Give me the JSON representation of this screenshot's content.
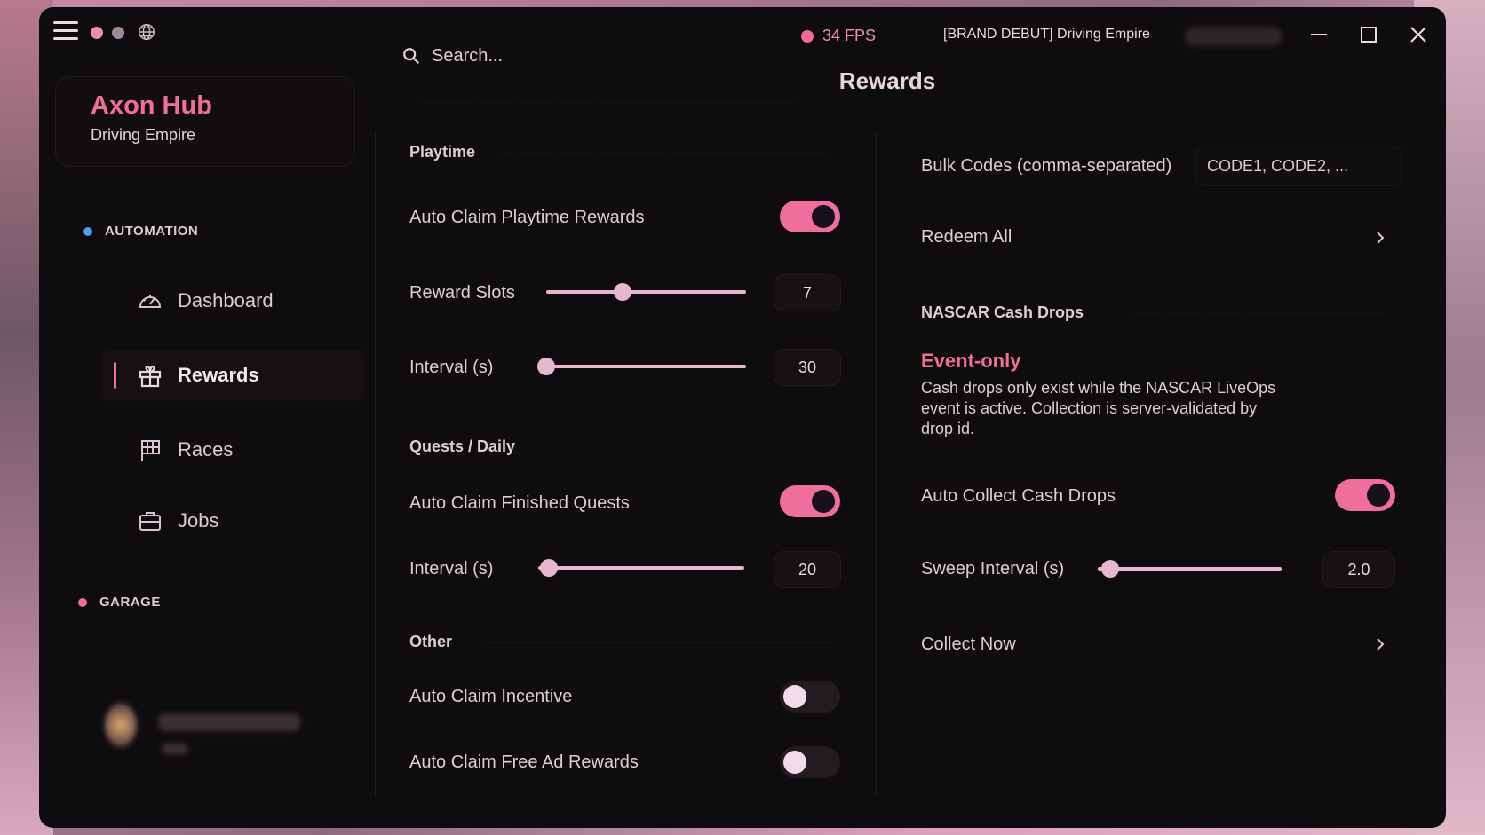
{
  "topbar": {
    "search_placeholder": "Search...",
    "fps": "34 FPS",
    "game_title": "[BRAND DEBUT] Driving Empire",
    "colors": {
      "dot1": "#e98fb0",
      "dot2": "#9a8a93",
      "accent": "#ef6e9c"
    }
  },
  "page": {
    "title": "Rewards"
  },
  "sidebar": {
    "brand_name": "Axon Hub",
    "brand_sub": "Driving Empire",
    "sections": [
      {
        "label": "AUTOMATION",
        "color": "#4b9df0"
      },
      {
        "label": "GARAGE",
        "color": "#ef6e9c"
      }
    ],
    "items": [
      {
        "label": "Dashboard",
        "icon": "gauge-icon"
      },
      {
        "label": "Rewards",
        "icon": "gift-icon",
        "active": true
      },
      {
        "label": "Races",
        "icon": "flag-icon"
      },
      {
        "label": "Jobs",
        "icon": "briefcase-icon"
      }
    ]
  },
  "left_panel": {
    "playtime": {
      "title": "Playtime",
      "auto_claim": {
        "label": "Auto Claim Playtime Rewards",
        "on": true
      },
      "reward_slots": {
        "label": "Reward Slots",
        "value": "7",
        "fraction": 0.38
      },
      "interval": {
        "label": "Interval (s)",
        "value": "30",
        "fraction": 0.03
      }
    },
    "quests": {
      "title": "Quests / Daily",
      "auto_claim": {
        "label": "Auto Claim Finished Quests",
        "on": true
      },
      "interval": {
        "label": "Interval (s)",
        "value": "20",
        "fraction": 0.05
      }
    },
    "other": {
      "title": "Other",
      "incentive": {
        "label": "Auto Claim Incentive",
        "on": false
      },
      "free_ad": {
        "label": "Auto Claim Free Ad Rewards",
        "on": false
      }
    }
  },
  "right_panel": {
    "bulk_codes": {
      "label": "Bulk Codes (comma-separated)",
      "placeholder": "CODE1, CODE2, ..."
    },
    "redeem_all": {
      "label": "Redeem All"
    },
    "nascar": {
      "title": "NASCAR Cash Drops",
      "event_title": "Event-only",
      "event_desc": "Cash drops only exist while the NASCAR LiveOps event is active. Collection is server-validated by drop id.",
      "auto_collect": {
        "label": "Auto Collect Cash Drops",
        "on": true
      },
      "sweep_interval": {
        "label": "Sweep Interval (s)",
        "value": "2.0",
        "fraction": 0.07
      },
      "collect_now": {
        "label": "Collect Now"
      }
    }
  }
}
